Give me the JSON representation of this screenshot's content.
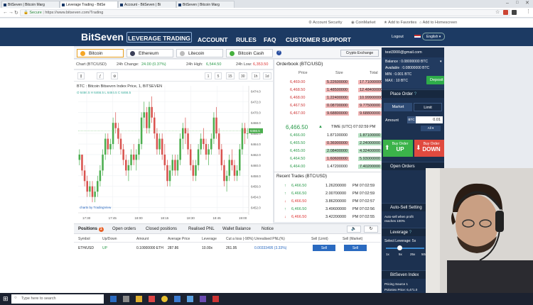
{
  "browser": {
    "tabs": [
      "BitSeven | Bitcoin Marg",
      "Leverage Trading - BitSe",
      "Account - BitSeven | Bi",
      "BitSeven | Bitcoin Marg"
    ],
    "secure_label": "Secure",
    "url": "https://www.bitseven.com/Trading"
  },
  "topstrip": {
    "account_security": "Account Security",
    "coinmarket": "CoinMarket",
    "add_favorites": "Add to Favorites",
    "add_homescreen": "Add to Homescreen"
  },
  "nav": {
    "logo": "BitSeven",
    "items": [
      "LEVERAGE TRADING",
      "ACCOUNT",
      "RULES",
      "FAQ",
      "CUSTOMER SUPPORT"
    ],
    "logout": "Logout",
    "language": "English"
  },
  "coins": [
    "Bitcoin",
    "Ethereum",
    "Litecoin",
    "Bitcoin Cash"
  ],
  "crypto_exchange": "Crypto Exchange",
  "stats": {
    "pair": "Chart (BTC/USD)",
    "change_label": "24h Change:",
    "change_value": "24.00 (0.37%)",
    "high_label": "24h High:",
    "high_value": "6,544.50",
    "low_label": "24h Low:",
    "low_value": "6,353.50"
  },
  "chart": {
    "title": "BTC : Bitcoin Bitseven Index Price, 1, BITSEVEN",
    "ohlc": "O 6466.5  H 6466.5  L 6466.5  C 6466.5",
    "intervals": [
      "1",
      "5",
      "15",
      "30",
      "1h",
      "1d"
    ],
    "yticks": [
      "6474.0",
      "6472.0",
      "6470.0",
      "6468.0",
      "6466.0",
      "6464.0",
      "6462.0",
      "6460.0",
      "6458.0",
      "6456.0",
      "6454.0",
      "6452.0"
    ],
    "xticks": [
      "17:30",
      "17:45",
      "18:00",
      "18:15",
      "18:30",
      "18:45",
      "19:00"
    ],
    "price_marker": "6466.5",
    "credit": "charts by TradingView"
  },
  "chart_data": {
    "type": "candlestick",
    "title": "BTC : Bitcoin Bitseven Index Price, 1, BITSEVEN",
    "ylim": [
      6451,
      6475
    ],
    "candles": [
      [
        6461,
        6463,
        6460,
        6462
      ],
      [
        6462,
        6462,
        6458,
        6459
      ],
      [
        6459,
        6460,
        6456,
        6457
      ],
      [
        6457,
        6458,
        6454,
        6455
      ],
      [
        6455,
        6457,
        6454,
        6456
      ],
      [
        6456,
        6457,
        6453,
        6454
      ],
      [
        6454,
        6456,
        6453,
        6455
      ],
      [
        6455,
        6458,
        6454,
        6457
      ],
      [
        6457,
        6460,
        6456,
        6459
      ],
      [
        6459,
        6463,
        6458,
        6462
      ],
      [
        6462,
        6466,
        6461,
        6465
      ],
      [
        6465,
        6466,
        6462,
        6463
      ],
      [
        6463,
        6465,
        6462,
        6464
      ],
      [
        6464,
        6469,
        6463,
        6468
      ],
      [
        6468,
        6470,
        6466,
        6467
      ],
      [
        6467,
        6468,
        6464,
        6465
      ],
      [
        6465,
        6466,
        6462,
        6463
      ],
      [
        6463,
        6464,
        6460,
        6461
      ],
      [
        6461,
        6462,
        6458,
        6459
      ],
      [
        6459,
        6461,
        6457,
        6460
      ],
      [
        6460,
        6463,
        6459,
        6462
      ],
      [
        6462,
        6464,
        6460,
        6461
      ],
      [
        6461,
        6463,
        6459,
        6462
      ],
      [
        6462,
        6465,
        6461,
        6464
      ],
      [
        6464,
        6470,
        6463,
        6469
      ],
      [
        6469,
        6472,
        6467,
        6470
      ],
      [
        6470,
        6471,
        6466,
        6467
      ],
      [
        6467,
        6472,
        6466,
        6471
      ],
      [
        6471,
        6473,
        6468,
        6469
      ],
      [
        6469,
        6470,
        6465,
        6466
      ],
      [
        6466,
        6467,
        6462,
        6463
      ],
      [
        6463,
        6466,
        6462,
        6465
      ],
      [
        6465,
        6466,
        6461,
        6462
      ],
      [
        6462,
        6464,
        6459,
        6460
      ],
      [
        6460,
        6461,
        6456,
        6457
      ],
      [
        6457,
        6460,
        6456,
        6459
      ],
      [
        6459,
        6462,
        6458,
        6461
      ],
      [
        6461,
        6462,
        6458,
        6459
      ],
      [
        6459,
        6462,
        6458,
        6461
      ],
      [
        6461,
        6466,
        6460,
        6465
      ],
      [
        6465,
        6468,
        6463,
        6467
      ],
      [
        6467,
        6469,
        6464,
        6466
      ],
      [
        6466,
        6467,
        6462,
        6463
      ],
      [
        6463,
        6464,
        6459,
        6460
      ],
      [
        6460,
        6461,
        6457,
        6458
      ],
      [
        6458,
        6461,
        6457,
        6460
      ],
      [
        6460,
        6464,
        6459,
        6463
      ],
      [
        6463,
        6466,
        6462,
        6465
      ],
      [
        6465,
        6467,
        6463,
        6464
      ],
      [
        6464,
        6465,
        6461,
        6462
      ],
      [
        6462,
        6464,
        6460,
        6463
      ],
      [
        6463,
        6466,
        6462,
        6465
      ],
      [
        6465,
        6470,
        6464,
        6469
      ],
      [
        6469,
        6471,
        6465,
        6466
      ],
      [
        6466,
        6467,
        6462,
        6463
      ],
      [
        6463,
        6464,
        6459,
        6460
      ],
      [
        6460,
        6461,
        6456,
        6457
      ],
      [
        6457,
        6459,
        6455,
        6458
      ],
      [
        6458,
        6462,
        6457,
        6461
      ],
      [
        6461,
        6463,
        6459,
        6460
      ],
      [
        6460,
        6461,
        6457,
        6458
      ],
      [
        6458,
        6460,
        6457,
        6459
      ],
      [
        6459,
        6464,
        6458,
        6463
      ],
      [
        6463,
        6468,
        6462,
        6467
      ],
      [
        6467,
        6468,
        6464,
        6466
      ],
      [
        6466,
        6467,
        6465,
        6466
      ]
    ]
  },
  "orderbook": {
    "title": "Orderbook (BTC/USD)",
    "headers": [
      "Price",
      "Size",
      "Total"
    ],
    "asks": [
      [
        "6,469.00",
        "5.22600000",
        "17.71000000"
      ],
      [
        "6,468.50",
        "1.48500000",
        "12.48400000"
      ],
      [
        "6,468.00",
        "1.22400000",
        "10.99900000"
      ],
      [
        "6,467.50",
        "0.08700000",
        "9.77500000"
      ],
      [
        "6,467.00",
        "9.68800000",
        "9.68800000"
      ]
    ],
    "mid_price": "6,466.50",
    "time": "TIME (UTC) 07:02:59 PM",
    "bids": [
      [
        "6,466.00",
        "1.87100000",
        "1.87100000"
      ],
      [
        "6,465.50",
        "0.36900000",
        "2.24000000"
      ],
      [
        "6,465.00",
        "2.08400000",
        "4.32400000"
      ],
      [
        "6,464.50",
        "1.60600000",
        "5.93000000"
      ],
      [
        "6,464.00",
        "1.47200000",
        "7.40200000"
      ]
    ]
  },
  "trades": {
    "title": "Recent Trades (BTC/USD)",
    "rows": [
      [
        "6,466.50",
        "1.26200000",
        "PM 07:02:59",
        "up"
      ],
      [
        "6,466.50",
        "2.00700000",
        "PM 07:02:59",
        "up"
      ],
      [
        "6,466.50",
        "3.86200000",
        "PM 07:02:57",
        "down"
      ],
      [
        "6,466.50",
        "3.49600000",
        "PM 07:02:56",
        "up"
      ],
      [
        "6,466.50",
        "3.42200000",
        "PM 07:02:55",
        "down"
      ]
    ]
  },
  "right": {
    "email": "test3900@gmail.com",
    "balance": "Balance : 0.08000000 BTC",
    "available": "Available : 0.08000000 BTC",
    "min": "MIN : 0.001 BTC",
    "max": "MAX : 10 BTC",
    "deposit": "Deposit",
    "place_order": "Place Order",
    "market": "Market",
    "limit": "Limit",
    "amount": "Amount",
    "currency": "BTC",
    "amount_value": "0.01",
    "all": "All",
    "buy_order": "Buy Order",
    "up": "UP",
    "down": "DOWN",
    "open_orders": "Open Orders",
    "auto_sell": "Auto-Sell Setting",
    "auto_sell_text": "Auto-sell when profit reaches 100%",
    "leverage": "Leverage",
    "select_leverage": "Select Leverage: 5x",
    "lev_options": [
      "1x",
      "5x",
      "25x",
      "50x"
    ],
    "index": "BitSeven Index",
    "pricing_source": "Pricing Source 1",
    "poloniex": "Poloniex Price: 6,471.0"
  },
  "positions": {
    "tabs": [
      "Positions",
      "Open orders",
      "Closed positions",
      "Realised PNL",
      "Wallet Balance",
      "Notice"
    ],
    "badge": "1",
    "headers": [
      "Symbol",
      "Up/Down",
      "Amount",
      "Average Price",
      "Leverage",
      "Cut a loss (-90%)",
      "Unrealised PNL(%)",
      "Sell (Limit)",
      "Sell (Market)"
    ],
    "row": [
      "ETH/USD",
      "UP",
      "0.10000000 ETH",
      "287.86",
      "10.00x",
      "261.95",
      "0.00333495 (3.33%)",
      "Sell",
      "Sell"
    ]
  },
  "taskbar": {
    "search": "Type here to search"
  },
  "colors": {
    "nav": "#1c3a63",
    "ask": "#f2b6b6",
    "bid": "#b8e2c4",
    "buy": "#3bb34a",
    "sell": "#e04a3f",
    "panel": "#1c3150"
  }
}
